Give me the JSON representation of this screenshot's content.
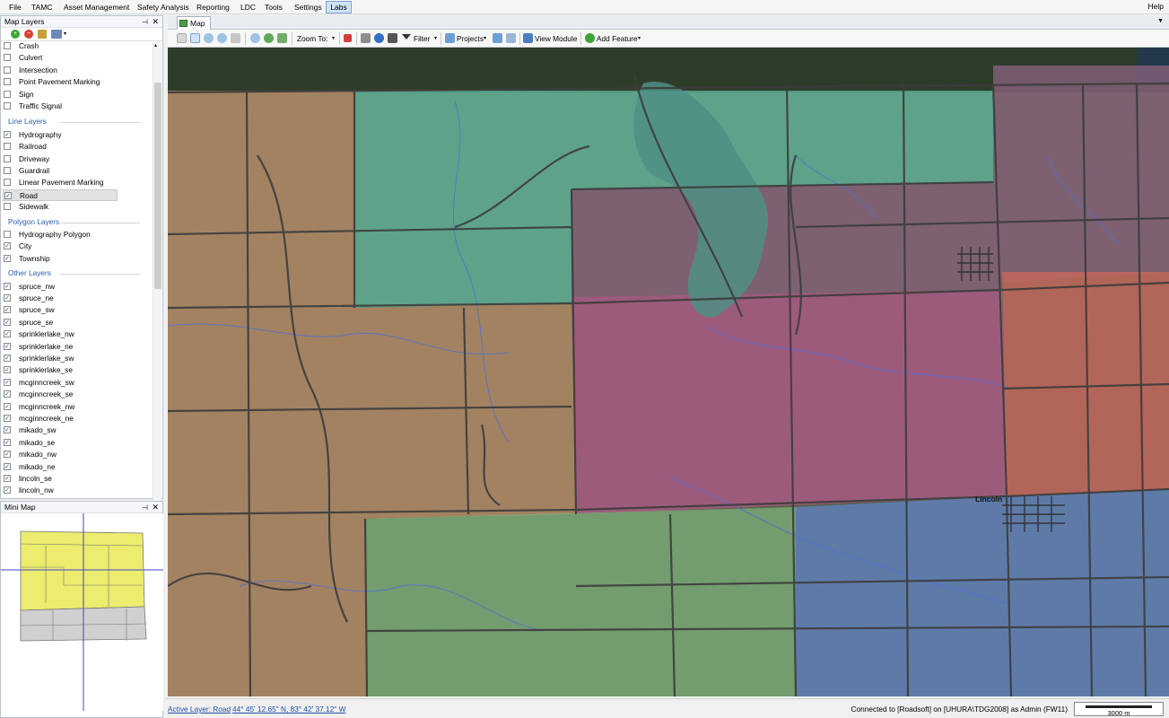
{
  "menu": {
    "items": [
      "File",
      "TAMC",
      "Asset Management",
      "Safety Analysis",
      "Reporting",
      "LDC",
      "Tools",
      "Settings",
      "Labs"
    ],
    "active": "Labs",
    "help": "Help"
  },
  "map_layers_panel": {
    "title": "Map Layers",
    "pin_icon": "pin-icon",
    "close_icon": "close-icon",
    "point_layers": [
      {
        "label": "Crash",
        "checked": false
      },
      {
        "label": "Culvert",
        "checked": false
      },
      {
        "label": "Intersection",
        "checked": false
      },
      {
        "label": "Point Pavement Marking",
        "checked": false
      },
      {
        "label": "Sign",
        "checked": false
      },
      {
        "label": "Traffic Signal",
        "checked": false
      }
    ],
    "line_layers_title": "Line Layers",
    "line_layers": [
      {
        "label": "Hydrography",
        "checked": true
      },
      {
        "label": "Railroad",
        "checked": false
      },
      {
        "label": "Driveway",
        "checked": false
      },
      {
        "label": "Guardrail",
        "checked": false
      },
      {
        "label": "Linear Pavement Marking",
        "checked": false
      },
      {
        "label": "Road",
        "checked": true,
        "selected": true
      },
      {
        "label": "Sidewalk",
        "checked": false
      }
    ],
    "polygon_layers_title": "Polygon Layers",
    "polygon_layers": [
      {
        "label": "Hydrography Polygon",
        "checked": false
      },
      {
        "label": "City",
        "checked": true
      },
      {
        "label": "Township",
        "checked": true
      }
    ],
    "other_layers_title": "Other Layers",
    "other_layers": [
      {
        "label": "spruce_nw",
        "checked": true
      },
      {
        "label": "spruce_ne",
        "checked": true
      },
      {
        "label": "spruce_sw",
        "checked": true
      },
      {
        "label": "spruce_se",
        "checked": true
      },
      {
        "label": "sprinklerlake_nw",
        "checked": true
      },
      {
        "label": "sprinklerlake_ne",
        "checked": true
      },
      {
        "label": "sprinklerlake_sw",
        "checked": true
      },
      {
        "label": "sprinklerlake_se",
        "checked": true
      },
      {
        "label": "mcginncreek_sw",
        "checked": true
      },
      {
        "label": "mcginncreek_se",
        "checked": true
      },
      {
        "label": "mcginncreek_nw",
        "checked": true
      },
      {
        "label": "mcginncreek_ne",
        "checked": true
      },
      {
        "label": "mikado_sw",
        "checked": true
      },
      {
        "label": "mikado_se",
        "checked": true
      },
      {
        "label": "mikado_nw",
        "checked": true
      },
      {
        "label": "mikado_ne",
        "checked": true
      },
      {
        "label": "lincoln_se",
        "checked": true
      },
      {
        "label": "lincoln_nw",
        "checked": true
      }
    ]
  },
  "mini_map": {
    "title": "Mini Map"
  },
  "map_tab": {
    "label": "Map"
  },
  "toolbar": {
    "zoom_to": "Zoom To:",
    "filter": "Filter",
    "projects": "Projects",
    "view_module": "View Module",
    "add_feature": "Add Feature"
  },
  "map": {
    "city_label": "Lincoln",
    "township_colors": {
      "tan": "#b38a68",
      "teal": "#5fb8a0",
      "purple": "#86617c",
      "magenta": "#b35a8d",
      "salmon": "#c8685e",
      "green": "#7bb07c",
      "blue": "#5f82c0"
    }
  },
  "status": {
    "active_layer": "Active Layer: Road",
    "coords": "44° 45' 12.65\" N, 83° 42' 37.12\" W",
    "connection": "Connected to [Roadsoft] on [UHURA\\TDG2008] as Admin (FW11)",
    "scale": "3000 m"
  }
}
